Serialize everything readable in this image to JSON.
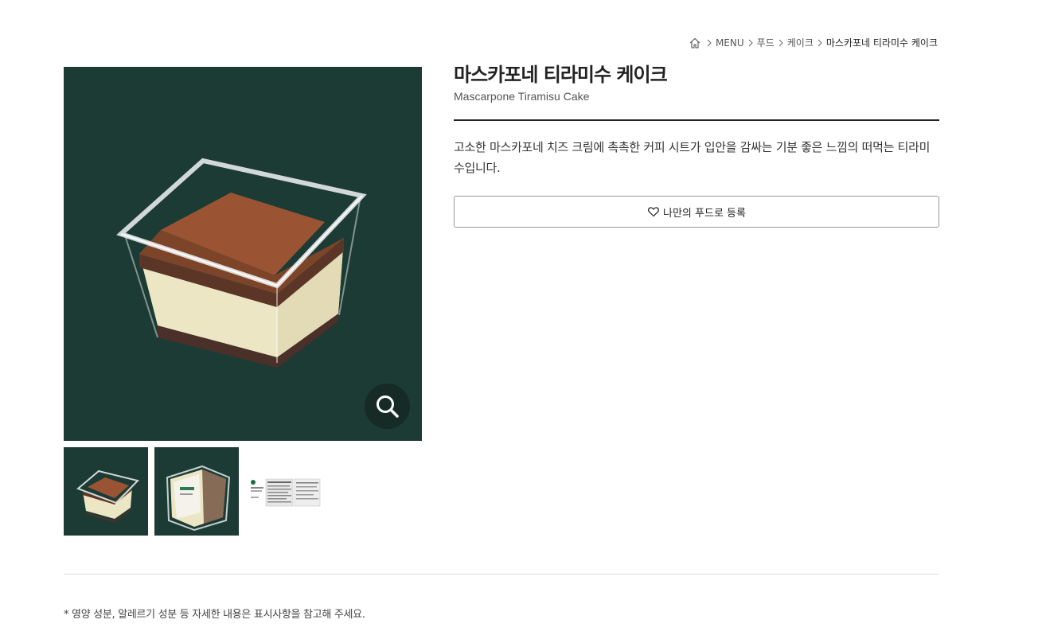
{
  "breadcrumb": {
    "home_icon": "home-icon",
    "items": [
      "MENU",
      "푸드",
      "케이크",
      "마스카포네 티라미수 케이크"
    ]
  },
  "product": {
    "title_ko": "마스카포네 티라미수 케이크",
    "title_en": "Mascarpone Tiramisu Cake",
    "description": "고소한 마스카포네 치즈 크림에 촉촉한 커피 시트가 입안을 감싸는 기분 좋은 느낌의 떠먹는 티라미수입니다.",
    "favorite_label": "나만의 푸드로 등록",
    "favorite_icon": "heart-icon",
    "zoom_icon": "magnifier-icon"
  },
  "colors": {
    "image_bg": "#1c3b35",
    "zoom_bg": "#162a26",
    "text": "#222222"
  },
  "footnote": "* 영양 성분, 알레르기 성분 등 자세한 내용은 표시사항을 참고해 주세요."
}
